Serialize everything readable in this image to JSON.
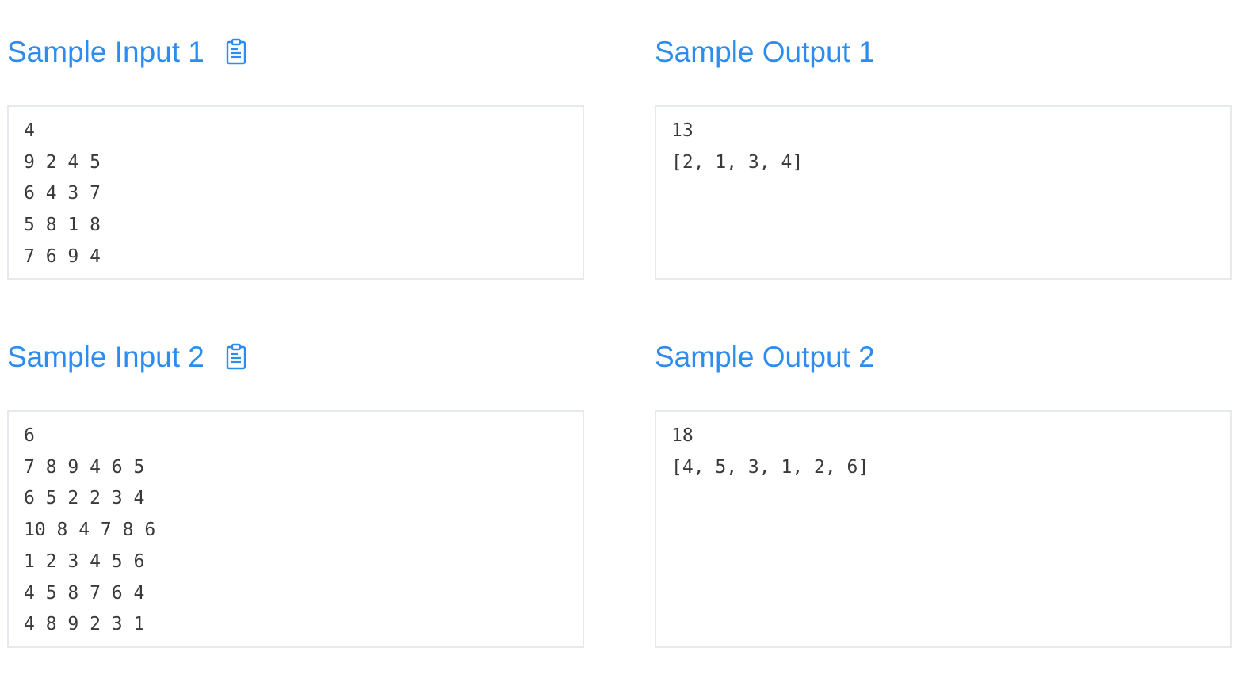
{
  "samples": [
    {
      "input_title": "Sample Input 1",
      "input_text": "4\n9 2 4 5\n6 4 3 7\n5 8 1 8\n7 6 9 4",
      "output_title": "Sample Output 1",
      "output_text": "13\n[2, 1, 3, 4]"
    },
    {
      "input_title": "Sample Input 2",
      "input_text": "6\n7 8 9 4 6 5\n6 5 2 2 3 4\n10 8 4 7 8 6\n1 2 3 4 5 6\n4 5 8 7 6 4\n4 8 9 2 3 1",
      "output_title": "Sample Output 2",
      "output_text": "18\n[4, 5, 3, 1, 2, 6]"
    }
  ],
  "icons": {
    "copy": "clipboard-icon"
  },
  "colors": {
    "heading": "#2d8cf0",
    "box_border": "#e6e9ee",
    "code_text": "#3a3a3a"
  }
}
